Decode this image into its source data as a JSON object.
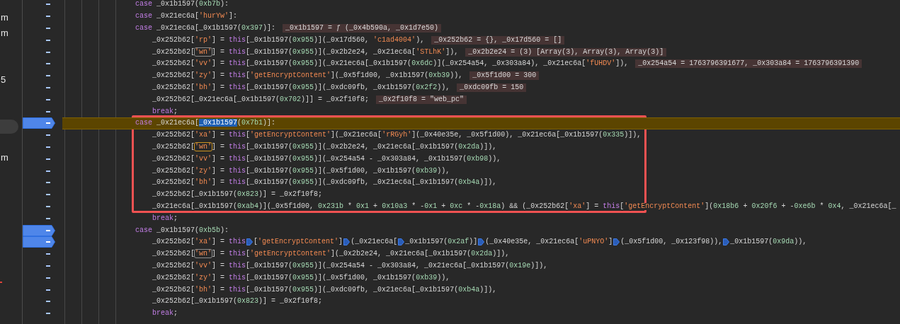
{
  "sidebar": [
    {
      "kind": "label",
      "text": "m",
      "selected": false
    },
    {
      "kind": "label",
      "text": "m",
      "selected": false
    },
    {
      "kind": "empty",
      "selected": false
    },
    {
      "kind": "empty",
      "selected": false
    },
    {
      "kind": "label",
      "text": "5",
      "selected": false
    },
    {
      "kind": "empty",
      "selected": false
    },
    {
      "kind": "empty",
      "selected": false
    },
    {
      "kind": "empty",
      "selected": true
    },
    {
      "kind": "empty",
      "selected": false
    },
    {
      "kind": "label",
      "text": "m",
      "selected": false
    },
    {
      "kind": "empty",
      "selected": false
    },
    {
      "kind": "empty",
      "selected": false
    },
    {
      "kind": "empty",
      "selected": false
    },
    {
      "kind": "empty",
      "selected": false
    },
    {
      "kind": "empty",
      "selected": false
    },
    {
      "kind": "empty",
      "selected": false
    },
    {
      "kind": "empty",
      "selected": false
    },
    {
      "kind": "error",
      "selected": false
    }
  ],
  "lines": [
    {
      "kind": "case",
      "breakpoint": false,
      "paused": false,
      "tokens": [
        {
          "kind": "kw",
          "text": "case"
        },
        {
          "kind": "plain",
          "text": " _0x1b1597("
        },
        {
          "kind": "num",
          "text": "0xb7b"
        },
        {
          "kind": "plain",
          "text": "):"
        }
      ]
    },
    {
      "kind": "case",
      "breakpoint": false,
      "paused": false,
      "tokens": [
        {
          "kind": "kw",
          "text": "case"
        },
        {
          "kind": "plain",
          "text": " _0x21ec6a["
        },
        {
          "kind": "str",
          "text": "'hurYw'"
        },
        {
          "kind": "plain",
          "text": "]:"
        }
      ]
    },
    {
      "kind": "case",
      "breakpoint": false,
      "paused": false,
      "tokens": [
        {
          "kind": "kw",
          "text": "case"
        },
        {
          "kind": "plain",
          "text": " _0x21ec6a[_0x1b1597("
        },
        {
          "kind": "num",
          "text": "0x397"
        },
        {
          "kind": "plain",
          "text": ")]:"
        },
        {
          "kind": "value",
          "text": "_0x1b1597 = ƒ (_0x4b590a, _0x1d7e50)"
        }
      ]
    },
    {
      "kind": "body",
      "breakpoint": false,
      "paused": false,
      "tokens": [
        {
          "kind": "plain",
          "text": "_0x252b62["
        },
        {
          "kind": "str",
          "text": "'rp'"
        },
        {
          "kind": "plain",
          "text": "] = "
        },
        {
          "kind": "kw",
          "text": "this"
        },
        {
          "kind": "plain",
          "text": "[_0x1b1597("
        },
        {
          "kind": "num",
          "text": "0x955"
        },
        {
          "kind": "plain",
          "text": ")](_0x17d560, "
        },
        {
          "kind": "str",
          "text": "'c1ad4004'"
        },
        {
          "kind": "plain",
          "text": "),"
        },
        {
          "kind": "value",
          "text": "_0x252b62 = {}, _0x17d560 = []"
        }
      ]
    },
    {
      "kind": "body",
      "breakpoint": false,
      "paused": false,
      "tokens": [
        {
          "kind": "plain",
          "text": "_0x252b62["
        },
        {
          "kind": "match",
          "text": "'wn'"
        },
        {
          "kind": "plain",
          "text": "] = "
        },
        {
          "kind": "kw",
          "text": "this"
        },
        {
          "kind": "plain",
          "text": "[_0x1b1597("
        },
        {
          "kind": "num",
          "text": "0x955"
        },
        {
          "kind": "plain",
          "text": ")](_0x2b2e24, _0x21ec6a["
        },
        {
          "kind": "str",
          "text": "'STLhK'"
        },
        {
          "kind": "plain",
          "text": "]),"
        },
        {
          "kind": "value",
          "text": "_0x2b2e24 = (3) [Array(3), Array(3), Array(3)]"
        }
      ]
    },
    {
      "kind": "body",
      "breakpoint": false,
      "paused": false,
      "tokens": [
        {
          "kind": "plain",
          "text": "_0x252b62["
        },
        {
          "kind": "str",
          "text": "'vv'"
        },
        {
          "kind": "plain",
          "text": "] = "
        },
        {
          "kind": "kw",
          "text": "this"
        },
        {
          "kind": "plain",
          "text": "[_0x1b1597("
        },
        {
          "kind": "num",
          "text": "0x955"
        },
        {
          "kind": "plain",
          "text": ")](_0x21ec6a[_0x1b1597("
        },
        {
          "kind": "num",
          "text": "0x6dc"
        },
        {
          "kind": "plain",
          "text": ")](_0x254a54, _0x303a84), _0x21ec6a["
        },
        {
          "kind": "str",
          "text": "'fUHDV'"
        },
        {
          "kind": "plain",
          "text": "]),"
        },
        {
          "kind": "value",
          "text": "_0x254a54 = 1763796391677, _0x303a84 = 1763796391390"
        }
      ]
    },
    {
      "kind": "body",
      "breakpoint": false,
      "paused": false,
      "tokens": [
        {
          "kind": "plain",
          "text": "_0x252b62["
        },
        {
          "kind": "str",
          "text": "'zy'"
        },
        {
          "kind": "plain",
          "text": "] = "
        },
        {
          "kind": "kw",
          "text": "this"
        },
        {
          "kind": "plain",
          "text": "["
        },
        {
          "kind": "str",
          "text": "'getEncryptContent'"
        },
        {
          "kind": "plain",
          "text": "](_0x5f1d00, _0x1b1597("
        },
        {
          "kind": "num",
          "text": "0xb39"
        },
        {
          "kind": "plain",
          "text": ")),"
        },
        {
          "kind": "value",
          "text": "_0x5f1d00 = 300"
        }
      ]
    },
    {
      "kind": "body",
      "breakpoint": false,
      "paused": false,
      "tokens": [
        {
          "kind": "plain",
          "text": "_0x252b62["
        },
        {
          "kind": "str",
          "text": "'bh'"
        },
        {
          "kind": "plain",
          "text": "] = "
        },
        {
          "kind": "kw",
          "text": "this"
        },
        {
          "kind": "plain",
          "text": "[_0x1b1597("
        },
        {
          "kind": "num",
          "text": "0x955"
        },
        {
          "kind": "plain",
          "text": ")](_0xdc09fb, _0x1b1597("
        },
        {
          "kind": "num",
          "text": "0x2f2"
        },
        {
          "kind": "plain",
          "text": ")),"
        },
        {
          "kind": "value",
          "text": "_0xdc09fb = 150"
        }
      ]
    },
    {
      "kind": "body",
      "breakpoint": false,
      "paused": false,
      "tokens": [
        {
          "kind": "plain",
          "text": "_0x252b62[_0x21ec6a[_0x1b1597("
        },
        {
          "kind": "num",
          "text": "0x702"
        },
        {
          "kind": "plain",
          "text": ")]] = _0x2f10f8;"
        },
        {
          "kind": "value",
          "text": "_0x2f10f8 = \"web_pc\""
        }
      ]
    },
    {
      "kind": "body",
      "breakpoint": false,
      "paused": false,
      "tokens": [
        {
          "kind": "kw",
          "text": "break"
        },
        {
          "kind": "plain",
          "text": ";"
        }
      ]
    },
    {
      "kind": "case",
      "breakpoint": true,
      "paused": true,
      "tokens": [
        {
          "kind": "kw",
          "text": "case"
        },
        {
          "kind": "plain",
          "text": " _0x21ec6a["
        },
        {
          "kind": "sel",
          "text": "_0x1b1597"
        },
        {
          "kind": "plain",
          "text": "("
        },
        {
          "kind": "num",
          "text": "0x7b1"
        },
        {
          "kind": "plain",
          "text": ")]:"
        }
      ]
    },
    {
      "kind": "body",
      "breakpoint": false,
      "paused": false,
      "tokens": [
        {
          "kind": "plain",
          "text": "_0x252b62["
        },
        {
          "kind": "str",
          "text": "'xa'"
        },
        {
          "kind": "plain",
          "text": "] = "
        },
        {
          "kind": "kw",
          "text": "this"
        },
        {
          "kind": "plain",
          "text": "["
        },
        {
          "kind": "str",
          "text": "'getEncryptContent'"
        },
        {
          "kind": "plain",
          "text": "](_0x21ec6a["
        },
        {
          "kind": "str",
          "text": "'rRGyh'"
        },
        {
          "kind": "plain",
          "text": "](_0x40e35e, _0x5f1d00), _0x21ec6a[_0x1b1597("
        },
        {
          "kind": "num",
          "text": "0x335"
        },
        {
          "kind": "plain",
          "text": ")]),"
        }
      ]
    },
    {
      "kind": "body",
      "breakpoint": false,
      "paused": false,
      "tokens": [
        {
          "kind": "plain",
          "text": "_0x252b62["
        },
        {
          "kind": "current",
          "text": "'wn'"
        },
        {
          "kind": "plain",
          "text": "] = "
        },
        {
          "kind": "kw",
          "text": "this"
        },
        {
          "kind": "plain",
          "text": "[_0x1b1597("
        },
        {
          "kind": "num",
          "text": "0x955"
        },
        {
          "kind": "plain",
          "text": ")](_0x2b2e24, _0x21ec6a[_0x1b1597("
        },
        {
          "kind": "num",
          "text": "0x2da"
        },
        {
          "kind": "plain",
          "text": ")]),"
        }
      ]
    },
    {
      "kind": "body",
      "breakpoint": false,
      "paused": false,
      "tokens": [
        {
          "kind": "plain",
          "text": "_0x252b62["
        },
        {
          "kind": "str",
          "text": "'vv'"
        },
        {
          "kind": "plain",
          "text": "] = "
        },
        {
          "kind": "kw",
          "text": "this"
        },
        {
          "kind": "plain",
          "text": "[_0x1b1597("
        },
        {
          "kind": "num",
          "text": "0x955"
        },
        {
          "kind": "plain",
          "text": ")](_0x254a54 - _0x303a84, _0x1b1597("
        },
        {
          "kind": "num",
          "text": "0xb98"
        },
        {
          "kind": "plain",
          "text": ")),"
        }
      ]
    },
    {
      "kind": "body",
      "breakpoint": false,
      "paused": false,
      "tokens": [
        {
          "kind": "plain",
          "text": "_0x252b62["
        },
        {
          "kind": "str",
          "text": "'zy'"
        },
        {
          "kind": "plain",
          "text": "] = "
        },
        {
          "kind": "kw",
          "text": "this"
        },
        {
          "kind": "plain",
          "text": "[_0x1b1597("
        },
        {
          "kind": "num",
          "text": "0x955"
        },
        {
          "kind": "plain",
          "text": ")](_0x5f1d00, _0x1b1597("
        },
        {
          "kind": "num",
          "text": "0xb39"
        },
        {
          "kind": "plain",
          "text": ")),"
        }
      ]
    },
    {
      "kind": "body",
      "breakpoint": false,
      "paused": false,
      "tokens": [
        {
          "kind": "plain",
          "text": "_0x252b62["
        },
        {
          "kind": "str",
          "text": "'bh'"
        },
        {
          "kind": "plain",
          "text": "] = "
        },
        {
          "kind": "kw",
          "text": "this"
        },
        {
          "kind": "plain",
          "text": "[_0x1b1597("
        },
        {
          "kind": "num",
          "text": "0x955"
        },
        {
          "kind": "plain",
          "text": ")](_0xdc09fb, _0x21ec6a[_0x1b1597("
        },
        {
          "kind": "num",
          "text": "0xb4a"
        },
        {
          "kind": "plain",
          "text": ")]),"
        }
      ]
    },
    {
      "kind": "body",
      "breakpoint": false,
      "paused": false,
      "tokens": [
        {
          "kind": "plain",
          "text": "_0x252b62[_0x1b1597("
        },
        {
          "kind": "num",
          "text": "0x823"
        },
        {
          "kind": "plain",
          "text": ")] = _0x2f10f8;"
        }
      ]
    },
    {
      "kind": "body",
      "breakpoint": false,
      "paused": false,
      "tokens": [
        {
          "kind": "plain",
          "text": "_0x21ec6a[_0x1b1597("
        },
        {
          "kind": "num",
          "text": "0xab4"
        },
        {
          "kind": "plain",
          "text": ")](_0x5f1d00, "
        },
        {
          "kind": "num",
          "text": "0x231b"
        },
        {
          "kind": "plain",
          "text": " * "
        },
        {
          "kind": "num",
          "text": "0x1"
        },
        {
          "kind": "plain",
          "text": " + "
        },
        {
          "kind": "num",
          "text": "0x10a3"
        },
        {
          "kind": "plain",
          "text": " * -"
        },
        {
          "kind": "num",
          "text": "0x1"
        },
        {
          "kind": "plain",
          "text": " + "
        },
        {
          "kind": "num",
          "text": "0xc"
        },
        {
          "kind": "plain",
          "text": " * -"
        },
        {
          "kind": "num",
          "text": "0x18a"
        },
        {
          "kind": "plain",
          "text": ") && (_0x252b62["
        },
        {
          "kind": "str",
          "text": "'xa'"
        },
        {
          "kind": "plain",
          "text": "] = "
        },
        {
          "kind": "kw",
          "text": "this"
        },
        {
          "kind": "plain",
          "text": "["
        },
        {
          "kind": "str",
          "text": "'getEncryptContent'"
        },
        {
          "kind": "plain",
          "text": "]("
        },
        {
          "kind": "num",
          "text": "0x18b6"
        },
        {
          "kind": "plain",
          "text": " + "
        },
        {
          "kind": "num",
          "text": "0x20f6"
        },
        {
          "kind": "plain",
          "text": " + -"
        },
        {
          "kind": "num",
          "text": "0xe6b"
        },
        {
          "kind": "plain",
          "text": " * "
        },
        {
          "kind": "num",
          "text": "0x4"
        },
        {
          "kind": "plain",
          "text": ", _0x21ec6a[_"
        }
      ]
    },
    {
      "kind": "body",
      "breakpoint": false,
      "paused": false,
      "tokens": [
        {
          "kind": "kw",
          "text": "break"
        },
        {
          "kind": "plain",
          "text": ";"
        }
      ]
    },
    {
      "kind": "case",
      "breakpoint": true,
      "paused": false,
      "tokens": [
        {
          "kind": "kw",
          "text": "case"
        },
        {
          "kind": "plain",
          "text": " _0x1b1597("
        },
        {
          "kind": "num",
          "text": "0xb5b"
        },
        {
          "kind": "plain",
          "text": "):"
        }
      ]
    },
    {
      "kind": "body",
      "breakpoint": true,
      "paused": false,
      "tokens": [
        {
          "kind": "plain",
          "text": "_0x252b62["
        },
        {
          "kind": "str",
          "text": "'xa'"
        },
        {
          "kind": "plain",
          "text": "] = "
        },
        {
          "kind": "kw",
          "text": "this"
        },
        {
          "kind": "bp"
        },
        {
          "kind": "plain",
          "text": "["
        },
        {
          "kind": "str",
          "text": "'getEncryptContent'"
        },
        {
          "kind": "plain",
          "text": "]"
        },
        {
          "kind": "bp"
        },
        {
          "kind": "plain",
          "text": "(_0x21ec6a["
        },
        {
          "kind": "bp"
        },
        {
          "kind": "plain",
          "text": "_0x1b1597("
        },
        {
          "kind": "num",
          "text": "0x2af"
        },
        {
          "kind": "plain",
          "text": ")]"
        },
        {
          "kind": "bp"
        },
        {
          "kind": "plain",
          "text": "(_0x40e35e, _0x21ec6a["
        },
        {
          "kind": "str",
          "text": "'uPNYO'"
        },
        {
          "kind": "plain",
          "text": "]"
        },
        {
          "kind": "bp"
        },
        {
          "kind": "plain",
          "text": "(_0x5f1d00, _0x123f98)),"
        },
        {
          "kind": "bp"
        },
        {
          "kind": "plain",
          "text": "_0x1b1597("
        },
        {
          "kind": "num",
          "text": "0x9da"
        },
        {
          "kind": "plain",
          "text": ")),"
        }
      ]
    },
    {
      "kind": "body",
      "breakpoint": false,
      "paused": false,
      "tokens": [
        {
          "kind": "plain",
          "text": "_0x252b62["
        },
        {
          "kind": "match",
          "text": "'wn'"
        },
        {
          "kind": "plain",
          "text": "] = "
        },
        {
          "kind": "kw",
          "text": "this"
        },
        {
          "kind": "plain",
          "text": "["
        },
        {
          "kind": "str",
          "text": "'getEncryptContent'"
        },
        {
          "kind": "plain",
          "text": "](_0x2b2e24, _0x21ec6a[_0x1b1597("
        },
        {
          "kind": "num",
          "text": "0x2da"
        },
        {
          "kind": "plain",
          "text": ")]),"
        }
      ]
    },
    {
      "kind": "body",
      "breakpoint": false,
      "paused": false,
      "tokens": [
        {
          "kind": "plain",
          "text": "_0x252b62["
        },
        {
          "kind": "str",
          "text": "'vv'"
        },
        {
          "kind": "plain",
          "text": "] = "
        },
        {
          "kind": "kw",
          "text": "this"
        },
        {
          "kind": "plain",
          "text": "[_0x1b1597("
        },
        {
          "kind": "num",
          "text": "0x955"
        },
        {
          "kind": "plain",
          "text": ")](_0x254a54 - _0x303a84, _0x21ec6a[_0x1b1597("
        },
        {
          "kind": "num",
          "text": "0x19e"
        },
        {
          "kind": "plain",
          "text": ")]),"
        }
      ]
    },
    {
      "kind": "body",
      "breakpoint": false,
      "paused": false,
      "tokens": [
        {
          "kind": "plain",
          "text": "_0x252b62["
        },
        {
          "kind": "str",
          "text": "'zy'"
        },
        {
          "kind": "plain",
          "text": "] = "
        },
        {
          "kind": "kw",
          "text": "this"
        },
        {
          "kind": "plain",
          "text": "[_0x1b1597("
        },
        {
          "kind": "num",
          "text": "0x955"
        },
        {
          "kind": "plain",
          "text": ")](_0x5f1d00, _0x1b1597("
        },
        {
          "kind": "num",
          "text": "0xb39"
        },
        {
          "kind": "plain",
          "text": ")),"
        }
      ]
    },
    {
      "kind": "body",
      "breakpoint": false,
      "paused": false,
      "tokens": [
        {
          "kind": "plain",
          "text": "_0x252b62["
        },
        {
          "kind": "str",
          "text": "'bh'"
        },
        {
          "kind": "plain",
          "text": "] = "
        },
        {
          "kind": "kw",
          "text": "this"
        },
        {
          "kind": "plain",
          "text": "[_0x1b1597("
        },
        {
          "kind": "num",
          "text": "0x955"
        },
        {
          "kind": "plain",
          "text": ")](_0xdc09fb, _0x21ec6a[_0x1b1597("
        },
        {
          "kind": "num",
          "text": "0xb4a"
        },
        {
          "kind": "plain",
          "text": ")]),"
        }
      ]
    },
    {
      "kind": "body",
      "breakpoint": false,
      "paused": false,
      "tokens": [
        {
          "kind": "plain",
          "text": "_0x252b62[_0x1b1597("
        },
        {
          "kind": "num",
          "text": "0x823"
        },
        {
          "kind": "plain",
          "text": ")] = _0x2f10f8;"
        }
      ]
    },
    {
      "kind": "body",
      "breakpoint": false,
      "paused": false,
      "tokens": [
        {
          "kind": "kw",
          "text": "break"
        },
        {
          "kind": "plain",
          "text": ";"
        }
      ]
    }
  ]
}
